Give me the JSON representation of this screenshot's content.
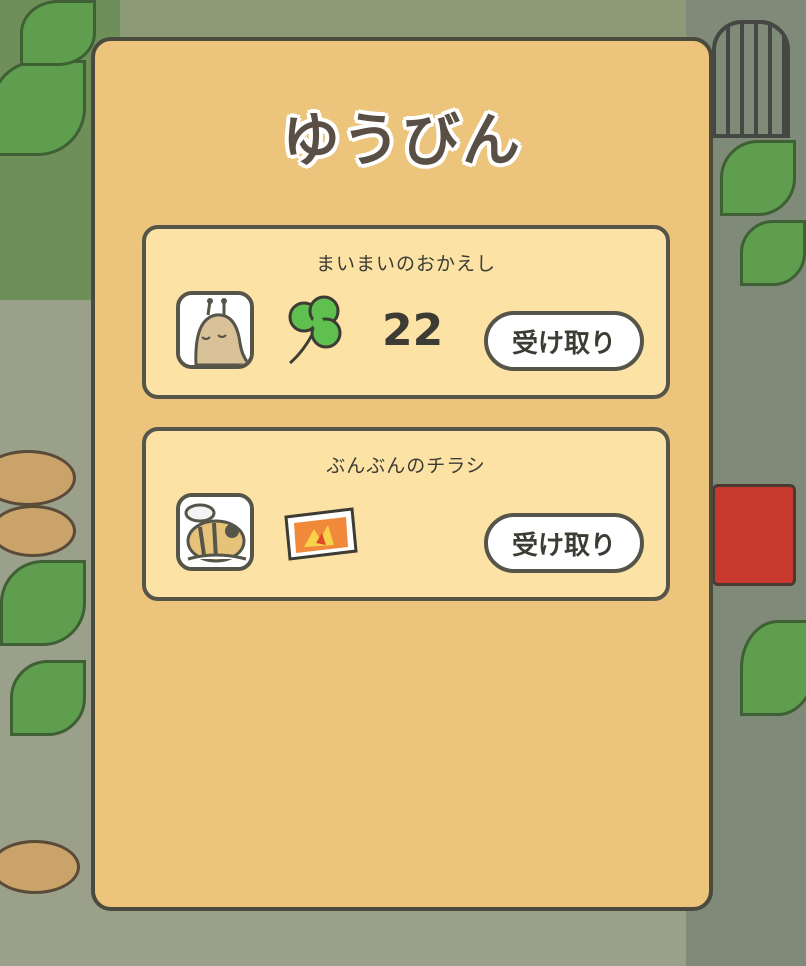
{
  "dialog": {
    "title": "ゆうびん",
    "items": [
      {
        "sender": "まいまいのおかえし",
        "avatar_icon": "snail-avatar-icon",
        "reward_icon": "clover-icon",
        "count": "22",
        "button_label": "受け取り"
      },
      {
        "sender": "ぶんぶんのチラシ",
        "avatar_icon": "bee-avatar-icon",
        "reward_icon": "flyer-icon",
        "button_label": "受け取り"
      }
    ]
  },
  "colors": {
    "panel": "#ecc47c",
    "card": "#fce3a5",
    "border": "#55554a",
    "clover": "#5fbf4f"
  }
}
